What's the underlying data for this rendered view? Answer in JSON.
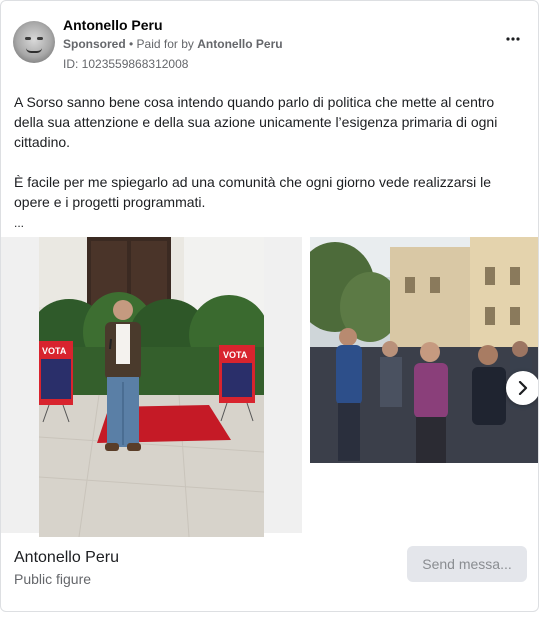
{
  "ad": {
    "page_name": "Antonello Peru",
    "sponsored_label": "Sponsored",
    "paid_for_prefix": " • Paid for by ",
    "payer": "Antonello Peru",
    "id_line": "ID: 1023559868312008",
    "more_icon": "ellipsis-icon",
    "body_paragraph_1": "A Sorso sanno bene cosa intendo quando parlo di politica che mette al centro della sua attenzione e della sua azione unicamente l’esigenza primaria di ogni cittadino.",
    "body_paragraph_2": "È facile per me spiegarlo ad una comunità che ogni giorno vede realizzarsi le opere e i progetti programmati.",
    "ellipsis": "...",
    "carousel": {
      "slide1_banner_text": "VOTA",
      "next_icon": "chevron-right-icon"
    },
    "footer": {
      "name": "Antonello Peru",
      "category": "Public figure",
      "cta_label": "Send messa..."
    }
  },
  "colors": {
    "text_primary": "#1c1e21",
    "text_secondary": "#65676b",
    "button_bg": "#e4e6eb",
    "button_text": "#8a8d91",
    "banner_red": "#d8242e"
  }
}
